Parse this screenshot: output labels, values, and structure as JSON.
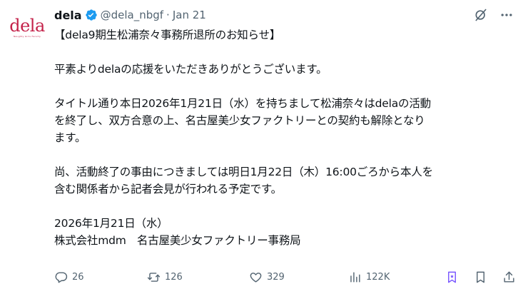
{
  "post": {
    "avatar_logo_text": "dela",
    "avatar_logo_subtext": "Naughty Girls Faculty",
    "display_name": "dela",
    "handle": "@dela_nbgf",
    "separator": "·",
    "date": "Jan 21",
    "lines": [
      "【dela9期生松浦奈々事務所退所のお知らせ】",
      "",
      "平素よりdelaの応援をいただきありがとうございます。",
      "",
      "タイトル通り本日2026年1月21日（水）を持ちまして松浦奈々はdelaの活動",
      "を終了し、双方合意の上、名古屋美少女ファクトリーとの契約も解除となり",
      "ます。",
      "",
      "尚、活動終了の事由につきましては明日1月22日（木）16:00ごろから本人を",
      "含む関係者から記者会見が行われる予定です。",
      "",
      "2026年1月21日（水）",
      "株式会社mdm　名古屋美少女ファクトリー事務局"
    ]
  },
  "actions": {
    "replies": "26",
    "reposts": "126",
    "likes": "329",
    "views": "122K"
  },
  "icons": {
    "verified": "verified-badge-icon",
    "grok": "grok-icon",
    "more": "more-icon",
    "reply": "reply-icon",
    "repost": "repost-icon",
    "like": "heart-icon",
    "views": "views-icon",
    "grok_bookmark": "grok-bookmark-icon",
    "bookmark": "bookmark-icon",
    "share": "share-icon"
  },
  "colors": {
    "text": "#0f1419",
    "secondary": "#536471",
    "verified": "#1d9bf0",
    "brand": "#c4224a",
    "grok_purple": "#7856ff"
  }
}
